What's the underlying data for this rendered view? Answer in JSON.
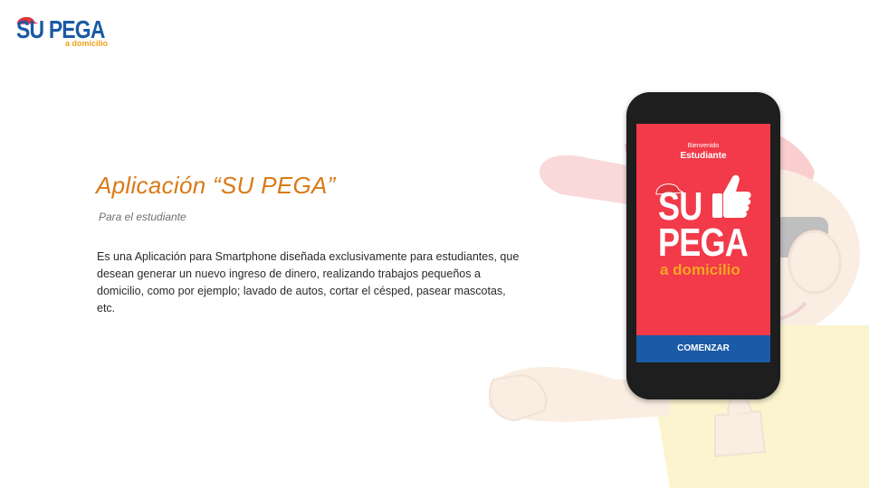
{
  "logo": {
    "main_text": "SU PEGA",
    "sub_text": "a domicilio",
    "brand_blue": "#1a5aa6",
    "brand_orange": "#f0a11b",
    "cap_color": "#e0343e"
  },
  "content": {
    "title": "Aplicación “SU PEGA”",
    "subtitle": "Para el estudiante",
    "description": "Es una Aplicación para Smartphone diseñada exclusivamente para estudiantes, que desean generar un nuevo ingreso de dinero, realizando trabajos pequeños a domicilio, como por ejemplo; lavado de autos, cortar el césped, pasear mascotas, etc.",
    "title_color": "#d97a17"
  },
  "phone": {
    "welcome": "Bienvenido",
    "student": "Estudiante",
    "logo_line1": "SU",
    "logo_line2": "PEGA",
    "logo_line3": "a domicilio",
    "button_label": "COMENZAR",
    "screen_color": "#f23a4a",
    "button_color": "#1a5aa6",
    "icons": [
      "cap-icon",
      "thumbs-up-icon"
    ]
  },
  "background": {
    "mascot": "mascot-illustration"
  }
}
